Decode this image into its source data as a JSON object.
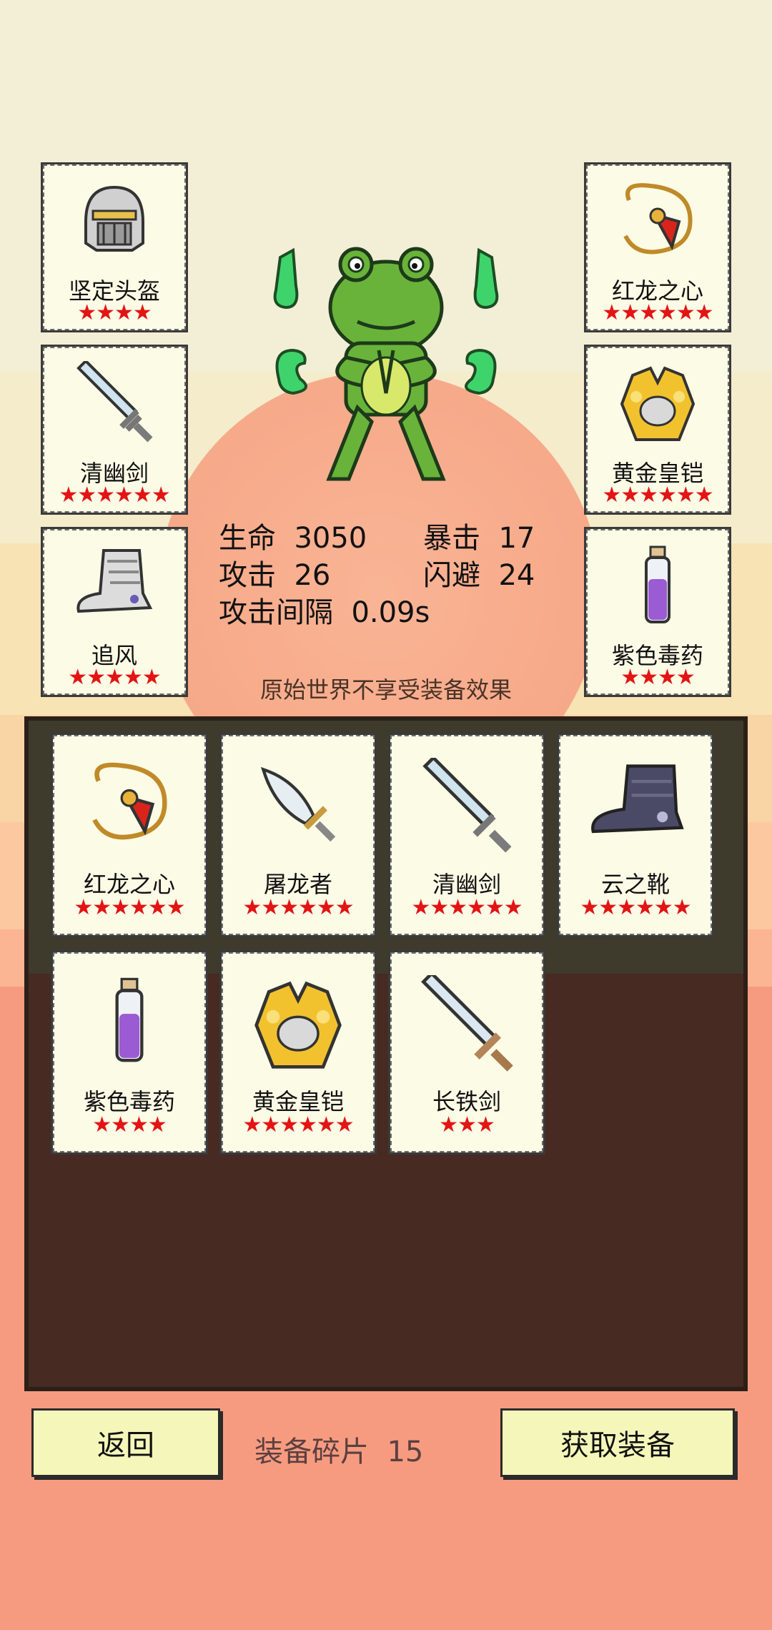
{
  "equipped": {
    "left": [
      {
        "name": "坚定头盔",
        "stars": "★★★★",
        "icon": "helmet-icon"
      },
      {
        "name": "清幽剑",
        "stars": "★★★★★★",
        "icon": "sword-icon"
      },
      {
        "name": "追风",
        "stars": "★★★★★",
        "icon": "boots-icon"
      }
    ],
    "right": [
      {
        "name": "红龙之心",
        "stars": "★★★★★★",
        "icon": "amulet-icon"
      },
      {
        "name": "黄金皇铠",
        "stars": "★★★★★★",
        "icon": "golden-armor-icon"
      },
      {
        "name": "紫色毒药",
        "stars": "★★★★",
        "icon": "poison-vial-icon"
      }
    ]
  },
  "stats": {
    "hp_label": "生命",
    "hp_value": "3050",
    "crit_label": "暴击",
    "crit_value": "17",
    "atk_label": "攻击",
    "atk_value": "26",
    "dodge_label": "闪避",
    "dodge_value": "24",
    "interval_label": "攻击间隔",
    "interval_value": "0.09s"
  },
  "notice": "原始世界不享受装备效果",
  "inventory": [
    {
      "name": "红龙之心",
      "stars": "★★★★★★",
      "icon": "amulet-icon"
    },
    {
      "name": "屠龙者",
      "stars": "★★★★★★",
      "icon": "dagger-icon"
    },
    {
      "name": "清幽剑",
      "stars": "★★★★★★",
      "icon": "sword-icon"
    },
    {
      "name": "云之靴",
      "stars": "★★★★★★",
      "icon": "dark-boots-icon"
    },
    {
      "name": "紫色毒药",
      "stars": "★★★★",
      "icon": "poison-vial-icon"
    },
    {
      "name": "黄金皇铠",
      "stars": "★★★★★★",
      "icon": "golden-armor-icon"
    },
    {
      "name": "长铁剑",
      "stars": "★★★",
      "icon": "long-sword-icon"
    }
  ],
  "footer": {
    "back_label": "返回",
    "fragments_label": "装备碎片",
    "fragments_value": "15",
    "get_label": "获取装备"
  },
  "colors": {
    "star": "#e31414",
    "button": "#f4f7b9",
    "card": "#fbfbe6"
  }
}
